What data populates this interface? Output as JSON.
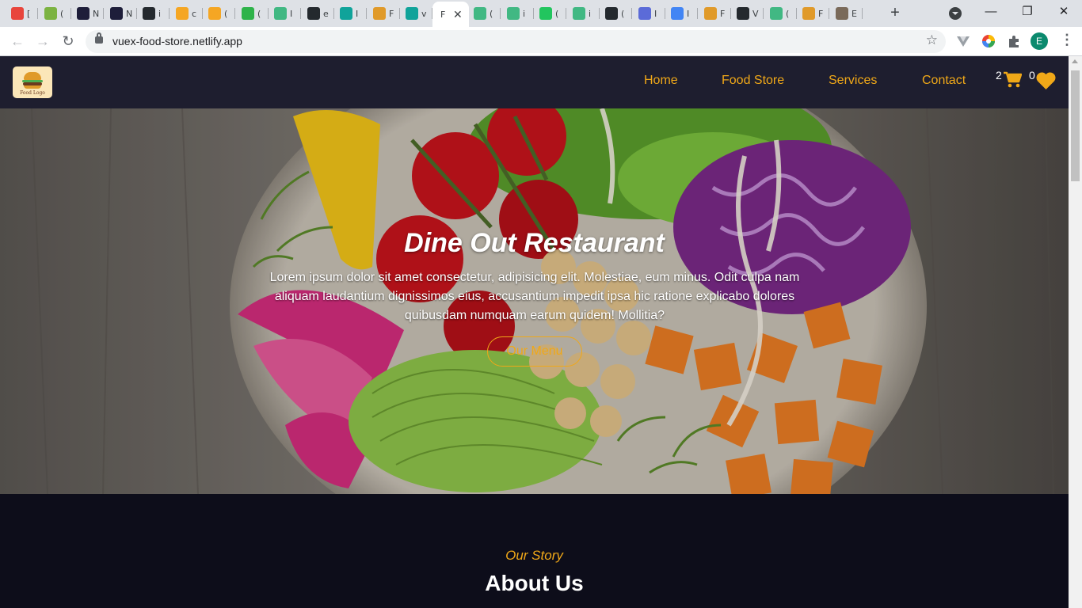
{
  "browser": {
    "tabs": [
      {
        "icon": "x-logo-icon",
        "title": "[",
        "color": "#e8453c"
      },
      {
        "icon": "m-badge-icon",
        "title": "(",
        "color": "#7cb342"
      },
      {
        "icon": "dev-logo-icon",
        "title": "N",
        "color": "#1e1e3a"
      },
      {
        "icon": "dev-logo-icon",
        "title": "N",
        "color": "#1e1e3a"
      },
      {
        "icon": "github-icon",
        "title": "i",
        "color": "#24292e"
      },
      {
        "icon": "flame-icon",
        "title": "c",
        "color": "#f5a623"
      },
      {
        "icon": "flame-icon",
        "title": "(",
        "color": "#f5a623"
      },
      {
        "icon": "n-badge-icon",
        "title": "(",
        "color": "#2eb34a"
      },
      {
        "icon": "vue-icon",
        "title": "I",
        "color": "#41b883"
      },
      {
        "icon": "github-icon",
        "title": "e",
        "color": "#24292e"
      },
      {
        "icon": "diamond-icon",
        "title": "I",
        "color": "#10a39a"
      },
      {
        "icon": "burger-icon",
        "title": "F",
        "color": "#e09a2a"
      },
      {
        "icon": "diamond-icon",
        "title": "v",
        "color": "#10a39a"
      },
      {
        "icon": "vue-icon",
        "title": "(",
        "color": "#41b883"
      },
      {
        "icon": "vue-icon",
        "title": "i",
        "color": "#41b883"
      },
      {
        "icon": "rc-badge-icon",
        "title": "(",
        "color": "#22c55e"
      },
      {
        "icon": "vue-icon",
        "title": "i",
        "color": "#41b883"
      },
      {
        "icon": "github-icon",
        "title": "(",
        "color": "#24292e"
      },
      {
        "icon": "mojo-icon",
        "title": "I",
        "color": "#5b6bd8"
      },
      {
        "icon": "google-icon",
        "title": "I",
        "color": "#4285f4"
      },
      {
        "icon": "burger-icon",
        "title": "F",
        "color": "#e09a2a"
      },
      {
        "icon": "github-icon",
        "title": "V",
        "color": "#24292e"
      },
      {
        "icon": "vue-icon",
        "title": "(",
        "color": "#41b883"
      },
      {
        "icon": "burger-icon",
        "title": "F",
        "color": "#e09a2a"
      },
      {
        "icon": "photo-icon",
        "title": "E",
        "color": "#7a6a5a"
      }
    ],
    "active_tab": {
      "title": "F",
      "close": "✕"
    },
    "new_tab": "+",
    "window": {
      "minimize": "—",
      "maximize": "❐",
      "close": "✕"
    },
    "nav": {
      "back": "←",
      "forward": "→",
      "reload": "↻"
    },
    "url": "vuex-food-store.netlify.app",
    "bookmark": "☆",
    "profile_initial": "E",
    "menu": "⋮"
  },
  "site": {
    "logo_text": "Food Logo",
    "nav": {
      "links": [
        "Home",
        "Food Store",
        "Services",
        "Contact"
      ],
      "cart_count": "2",
      "favorites_count": "0"
    },
    "hero": {
      "title": "Dine Out Restaurant",
      "description": "Lorem ipsum dolor sit amet consectetur, adipisicing elit. Molestiae, eum minus. Odit culpa nam aliquam laudantium dignissimos eius, accusantium impedit ipsa hic ratione explicabo dolores quibusdam numquam earum quidem! Mollitia?",
      "button": "Our Menu"
    },
    "about": {
      "subtitle": "Our Story",
      "title": "About Us"
    }
  },
  "colors": {
    "accent": "#f0a818",
    "nav_bg": "#1e1e2f",
    "page_bg": "#0d0d1a"
  }
}
